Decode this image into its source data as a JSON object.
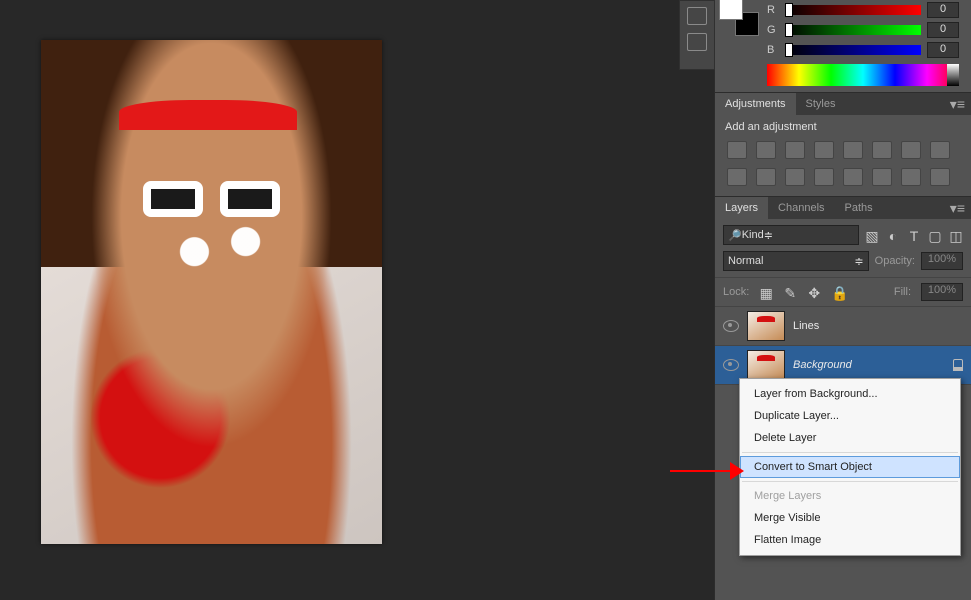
{
  "color": {
    "r_label": "R",
    "g_label": "G",
    "b_label": "B",
    "r_value": "0",
    "g_value": "0",
    "b_value": "0"
  },
  "adjustments": {
    "tab_adjustments": "Adjustments",
    "tab_styles": "Styles",
    "title": "Add an adjustment"
  },
  "layers": {
    "tab_layers": "Layers",
    "tab_channels": "Channels",
    "tab_paths": "Paths",
    "filter_kind": "Kind",
    "blend_mode": "Normal",
    "opacity_label": "Opacity:",
    "opacity_value": "100%",
    "lock_label": "Lock:",
    "fill_label": "Fill:",
    "fill_value": "100%",
    "items": [
      {
        "name": "Lines"
      },
      {
        "name": "Background"
      }
    ]
  },
  "context_menu": {
    "items": [
      {
        "label": "Layer from Background...",
        "disabled": false
      },
      {
        "label": "Duplicate Layer...",
        "disabled": false
      },
      {
        "label": "Delete Layer",
        "disabled": false
      },
      {
        "sep": true
      },
      {
        "label": "Convert to Smart Object",
        "disabled": false,
        "hover": true
      },
      {
        "sep": true
      },
      {
        "label": "Merge Layers",
        "disabled": true
      },
      {
        "label": "Merge Visible",
        "disabled": false
      },
      {
        "label": "Flatten Image",
        "disabled": false
      }
    ]
  }
}
